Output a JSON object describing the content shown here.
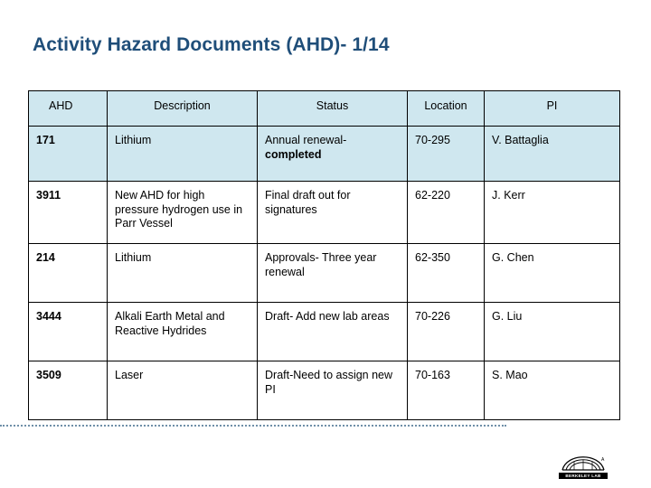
{
  "slide": {
    "title": "Activity Hazard Documents (AHD)- 1/14",
    "accent_color": "#1f4e79",
    "header_fill": "#cfe7ef",
    "table": {
      "columns": [
        "AHD",
        "Description",
        "Status",
        "Location",
        "PI"
      ],
      "rows": [
        {
          "ahd": "171",
          "description": "Lithium",
          "status_normal": "Annual renewal-",
          "status_bold": "completed",
          "location": "70-295",
          "pi": "V. Battaglia",
          "shaded": true
        },
        {
          "ahd": "3911",
          "description": "New AHD for high pressure hydrogen use in Parr Vessel",
          "status_normal": "Final draft out for signatures",
          "status_bold": "",
          "location": "62-220",
          "pi": "J. Kerr",
          "shaded": false
        },
        {
          "ahd": "214",
          "description": "Lithium",
          "status_normal": "Approvals- Three year renewal",
          "status_bold": "",
          "location": "62-350",
          "pi": "G. Chen",
          "shaded": false
        },
        {
          "ahd": "3444",
          "description": "Alkali Earth Metal and Reactive Hydrides",
          "status_normal": "Draft- Add new lab areas",
          "status_bold": "",
          "location": "70-226",
          "pi": "G. Liu",
          "shaded": false
        },
        {
          "ahd": "3509",
          "description": "Laser",
          "status_normal": "Draft-Need to assign new PI",
          "status_bold": "",
          "location": "70-163",
          "pi": "S. Mao",
          "shaded": false
        }
      ]
    },
    "footer": {
      "logo_caption": "BERKELEY LAB"
    }
  }
}
